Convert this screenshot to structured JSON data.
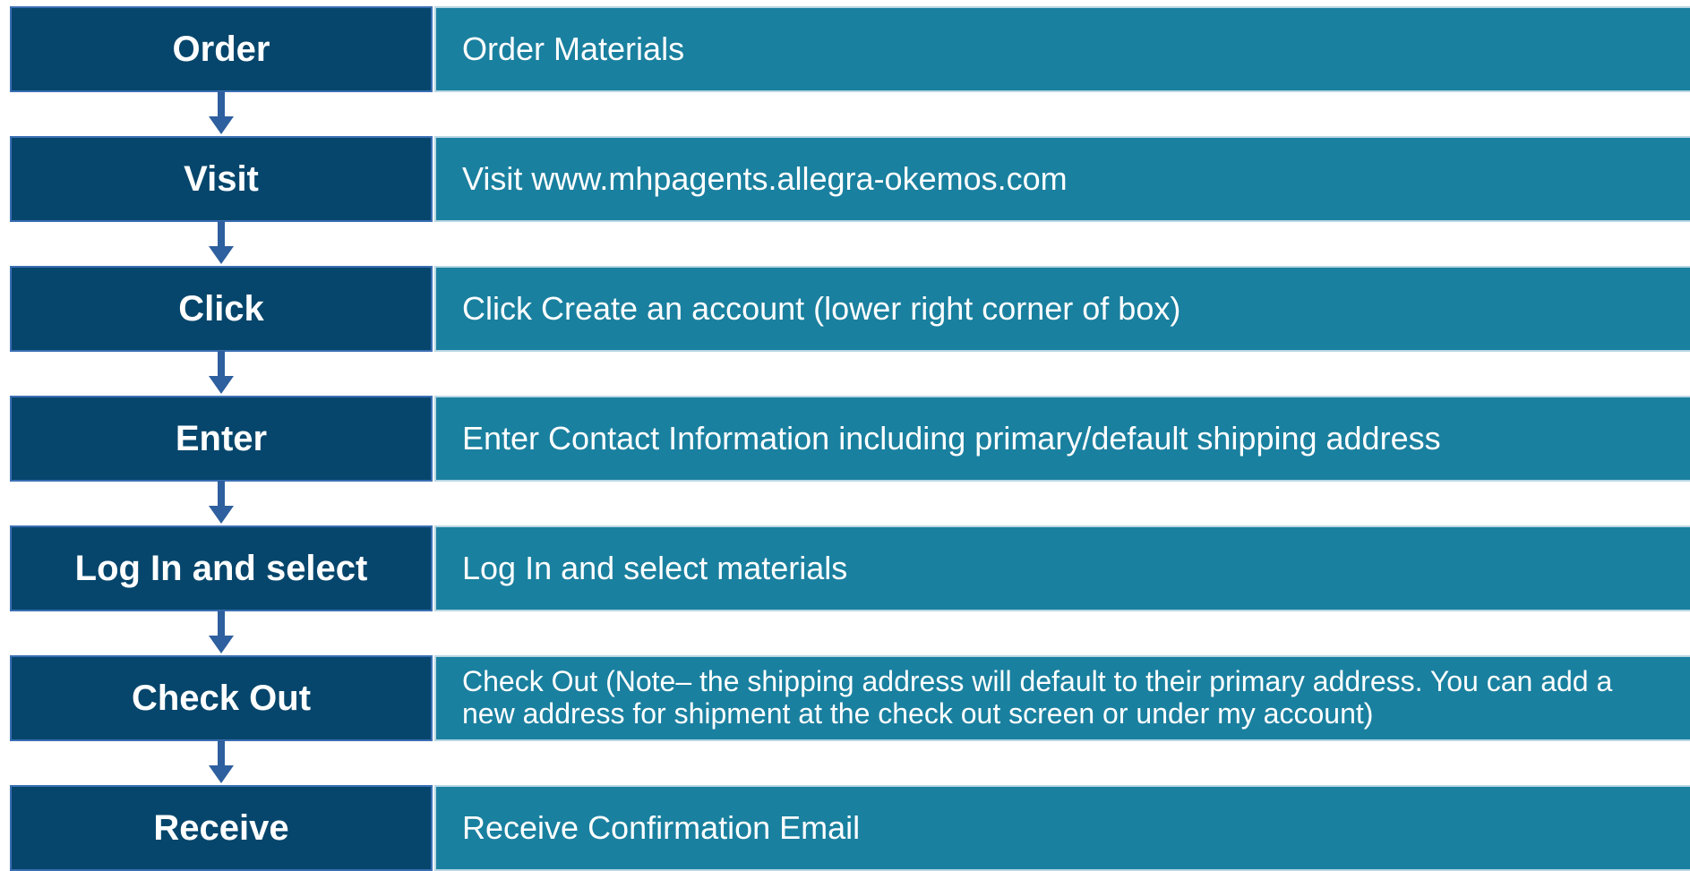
{
  "colors": {
    "label_bg": "#06466c",
    "label_border": "#3b6fb4",
    "desc_bg": "#1a809f",
    "desc_border": "#b9d7e4",
    "arrow": "#2e5f9e",
    "text": "#ffffff"
  },
  "steps": [
    {
      "label": "Order",
      "description": "Order Materials"
    },
    {
      "label": "Visit",
      "description": "Visit www.mhpagents.allegra-okemos.com"
    },
    {
      "label": "Click",
      "description": "Click Create an account (lower right corner of box)"
    },
    {
      "label": "Enter",
      "description": "Enter Contact Information including primary/default shipping address"
    },
    {
      "label": "Log In and select",
      "description": "Log In and select materials"
    },
    {
      "label": "Check Out",
      "description": "Check Out (Note– the shipping address will default to their primary address. You can add a new address for shipment at the check out screen or under my account)"
    },
    {
      "label": "Receive",
      "description": "Receive Confirmation Email"
    }
  ]
}
